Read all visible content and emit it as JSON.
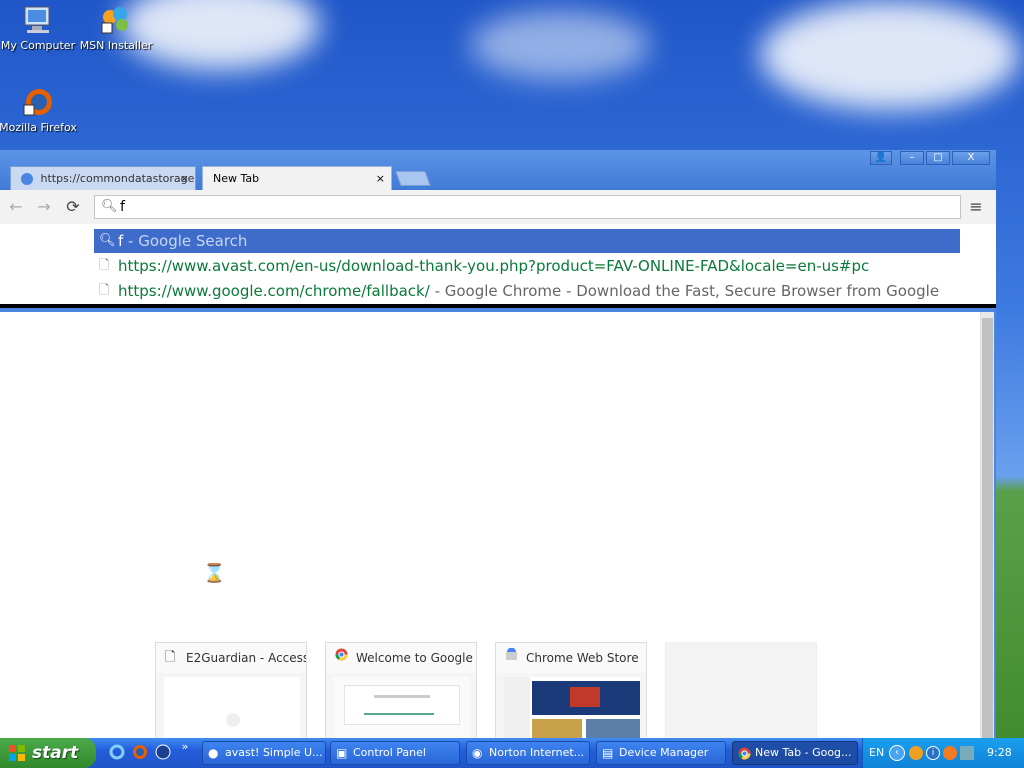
{
  "desktop": {
    "icons": [
      {
        "label": "My Computer",
        "icon": "computer-icon"
      },
      {
        "label": "MSN Installer",
        "icon": "msn-icon"
      },
      {
        "label": "Mozilla Firefox",
        "icon": "firefox-icon"
      }
    ]
  },
  "browser": {
    "tabs": [
      {
        "label": "https://commondatastorage",
        "close": "×"
      },
      {
        "label": "New Tab",
        "close": "×"
      }
    ],
    "window_buttons": {
      "profile": "👤",
      "minimize": "–",
      "maximize": "□",
      "close": "X"
    },
    "nav": {
      "back": "←",
      "forward": "→",
      "reload": "⟳",
      "menu": "≡"
    },
    "omnibox": {
      "value": "f"
    },
    "suggestions": [
      {
        "query": "f",
        "rest": " - Google Search"
      },
      {
        "url": "https://www.avast.com/en-us/download-thank-you.php?product=FAV-ONLINE-FAD&locale=en-us#pc",
        "title": ""
      },
      {
        "url": "https://www.google.com/chrome/fallback/",
        "title": " - Google Chrome - Download the Fast, Secure Browser from Google"
      }
    ],
    "tiles": [
      {
        "title": "E2Guardian - Access"
      },
      {
        "title": "Welcome to Google C"
      },
      {
        "title": "Chrome Web Store"
      },
      {
        "title": ""
      }
    ]
  },
  "taskbar": {
    "start_label": "start",
    "quicklaunch_more": "»",
    "tasks": [
      {
        "label": "avast! Simple U..."
      },
      {
        "label": "Control Panel"
      },
      {
        "label": "Norton Internet..."
      },
      {
        "label": "Device Manager"
      },
      {
        "label": "New Tab - Goog..."
      }
    ],
    "tray": {
      "lang": "EN",
      "clock": "9:28"
    }
  },
  "colors": {
    "selection": "#3f6ccb",
    "url_green": "#0a7a3a",
    "taskbar_blue": "#245edb",
    "start_green": "#2f8a2c"
  }
}
